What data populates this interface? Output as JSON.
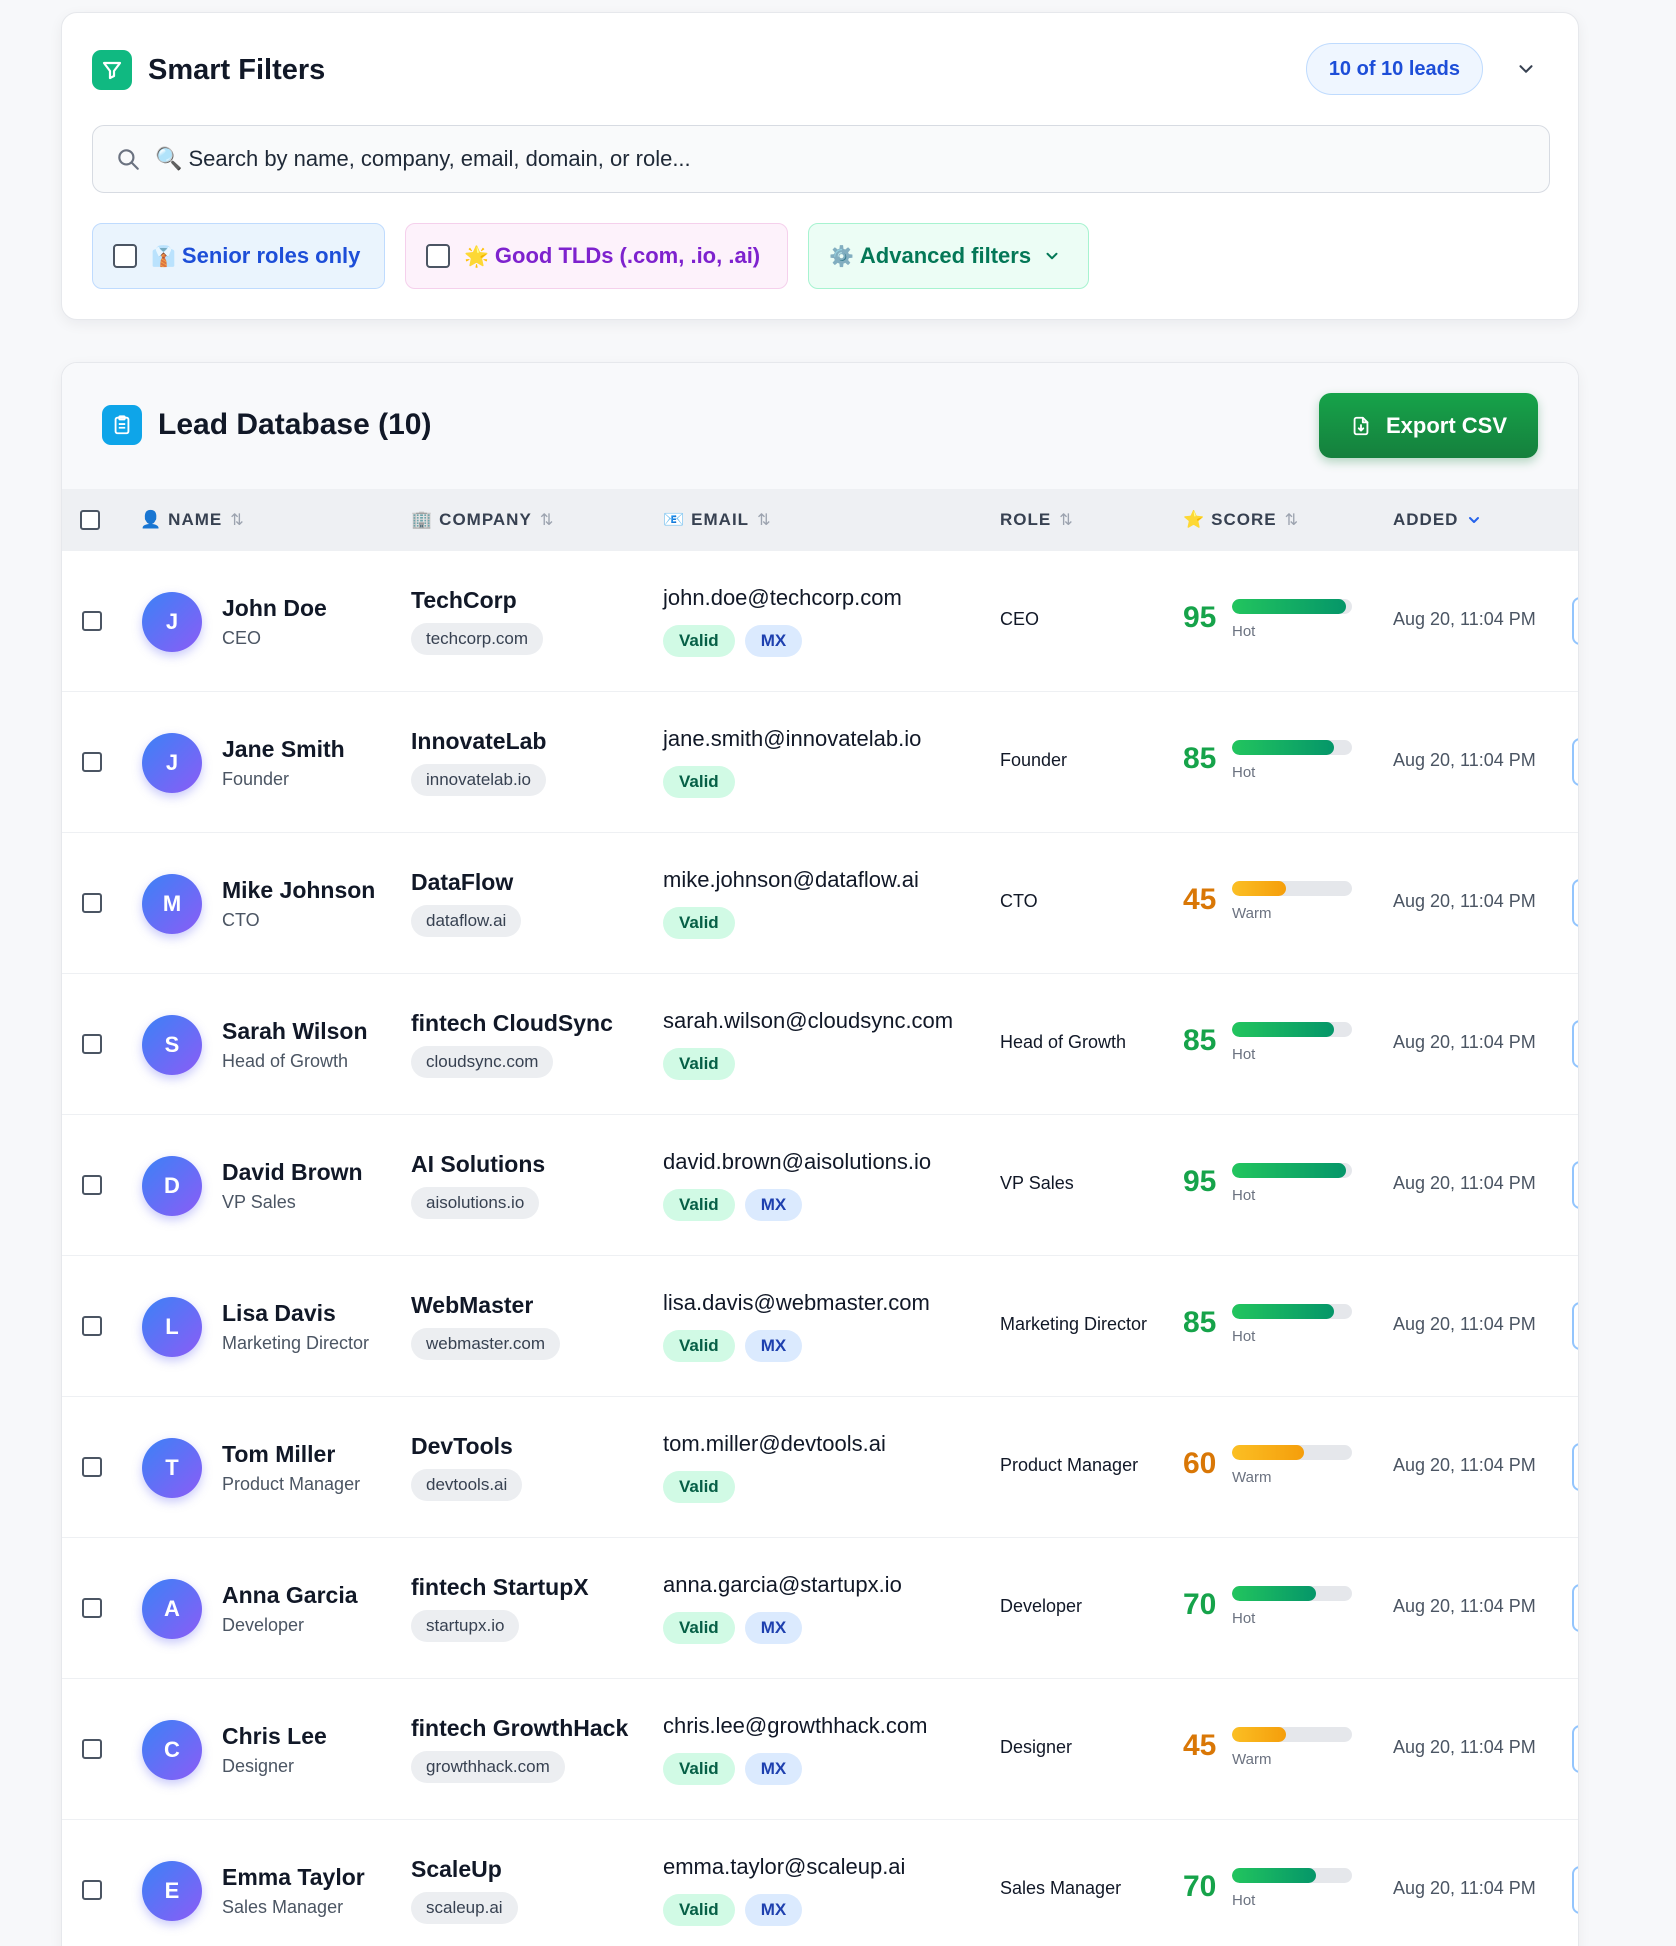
{
  "filters": {
    "title": "Smart Filters",
    "leads_count": "10 of 10 leads",
    "search_placeholder": "🔍 Search by name, company, email, domain, or role...",
    "chips": {
      "senior": {
        "emoji": "👔",
        "label": "Senior roles only"
      },
      "tld": {
        "emoji": "🌟",
        "label": "Good TLDs (.com, .io, .ai)"
      },
      "advanced": {
        "emoji": "⚙️",
        "label": "Advanced filters"
      }
    }
  },
  "database": {
    "title": "Lead Database (10)",
    "export_label": "Export CSV",
    "columns": {
      "name": {
        "emoji": "👤",
        "label": "NAME",
        "sort": "⇅"
      },
      "company": {
        "emoji": "🏢",
        "label": "COMPANY",
        "sort": "⇅"
      },
      "email": {
        "emoji": "📧",
        "label": "EMAIL",
        "sort": "⇅"
      },
      "role": {
        "label": "ROLE",
        "sort": "⇅"
      },
      "score": {
        "emoji": "⭐",
        "label": "SCORE",
        "sort": "⇅"
      },
      "added": {
        "label": "ADDED"
      }
    }
  },
  "leads": [
    {
      "initial": "J",
      "name": "John Doe",
      "title": "CEO",
      "company": "TechCorp",
      "domain": "techcorp.com",
      "email": "john.doe@techcorp.com",
      "valid": "Valid",
      "mx": "MX",
      "role": "CEO",
      "score": 95,
      "score_text": "95",
      "status": "Hot",
      "added": "Aug 20, 11:04 PM"
    },
    {
      "initial": "J",
      "name": "Jane Smith",
      "title": "Founder",
      "company": "InnovateLab",
      "domain": "innovatelab.io",
      "email": "jane.smith@innovatelab.io",
      "valid": "Valid",
      "mx": null,
      "role": "Founder",
      "score": 85,
      "score_text": "85",
      "status": "Hot",
      "added": "Aug 20, 11:04 PM"
    },
    {
      "initial": "M",
      "name": "Mike Johnson",
      "title": "CTO",
      "company": "DataFlow",
      "domain": "dataflow.ai",
      "email": "mike.johnson@dataflow.ai",
      "valid": "Valid",
      "mx": null,
      "role": "CTO",
      "score": 45,
      "score_text": "45",
      "status": "Warm",
      "added": "Aug 20, 11:04 PM"
    },
    {
      "initial": "S",
      "name": "Sarah Wilson",
      "title": "Head of Growth",
      "company": "fintech CloudSync",
      "domain": "cloudsync.com",
      "email": "sarah.wilson@cloudsync.com",
      "valid": "Valid",
      "mx": null,
      "role": "Head of Growth",
      "score": 85,
      "score_text": "85",
      "status": "Hot",
      "added": "Aug 20, 11:04 PM"
    },
    {
      "initial": "D",
      "name": "David Brown",
      "title": "VP Sales",
      "company": "AI Solutions",
      "domain": "aisolutions.io",
      "email": "david.brown@aisolutions.io",
      "valid": "Valid",
      "mx": "MX",
      "role": "VP Sales",
      "score": 95,
      "score_text": "95",
      "status": "Hot",
      "added": "Aug 20, 11:04 PM"
    },
    {
      "initial": "L",
      "name": "Lisa Davis",
      "title": "Marketing Director",
      "company": "WebMaster",
      "domain": "webmaster.com",
      "email": "lisa.davis@webmaster.com",
      "valid": "Valid",
      "mx": "MX",
      "role": "Marketing Director",
      "score": 85,
      "score_text": "85",
      "status": "Hot",
      "added": "Aug 20, 11:04 PM"
    },
    {
      "initial": "T",
      "name": "Tom Miller",
      "title": "Product Manager",
      "company": "DevTools",
      "domain": "devtools.ai",
      "email": "tom.miller@devtools.ai",
      "valid": "Valid",
      "mx": null,
      "role": "Product Manager",
      "score": 60,
      "score_text": "60",
      "status": "Warm",
      "added": "Aug 20, 11:04 PM"
    },
    {
      "initial": "A",
      "name": "Anna Garcia",
      "title": "Developer",
      "company": "fintech StartupX",
      "domain": "startupx.io",
      "email": "anna.garcia@startupx.io",
      "valid": "Valid",
      "mx": "MX",
      "role": "Developer",
      "score": 70,
      "score_text": "70",
      "status": "Hot",
      "added": "Aug 20, 11:04 PM"
    },
    {
      "initial": "C",
      "name": "Chris Lee",
      "title": "Designer",
      "company": "fintech GrowthHack",
      "domain": "growthhack.com",
      "email": "chris.lee@growthhack.com",
      "valid": "Valid",
      "mx": "MX",
      "role": "Designer",
      "score": 45,
      "score_text": "45",
      "status": "Warm",
      "added": "Aug 20, 11:04 PM"
    },
    {
      "initial": "E",
      "name": "Emma Taylor",
      "title": "Sales Manager",
      "company": "ScaleUp",
      "domain": "scaleup.ai",
      "email": "emma.taylor@scaleup.ai",
      "valid": "Valid",
      "mx": "MX",
      "role": "Sales Manager",
      "score": 70,
      "score_text": "70",
      "status": "Hot",
      "added": "Aug 20, 11:04 PM"
    }
  ]
}
